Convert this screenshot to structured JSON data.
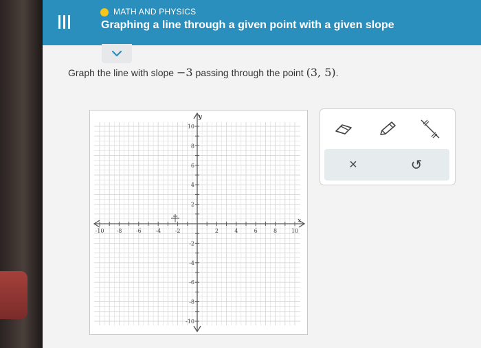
{
  "header": {
    "topic": "MATH AND PHYSICS",
    "title": "Graphing a line through a given point with a given slope"
  },
  "prompt": {
    "text_before": "Graph the line with slope ",
    "slope": "−3",
    "text_middle": " passing through the point ",
    "point": "(3, 5)",
    "text_after": "."
  },
  "graph": {
    "x_axis_label": "x",
    "y_axis_label": "y",
    "x_range": [
      -10,
      10
    ],
    "y_range": [
      -10,
      10
    ],
    "x_tick_labels": [
      "-10",
      "-8",
      "-6",
      "-4",
      "-2",
      "2",
      "4",
      "6",
      "8",
      "10"
    ],
    "y_tick_labels": [
      "10",
      "8",
      "6",
      "4",
      "2",
      "-2",
      "-4",
      "-6",
      "-8",
      "-10"
    ],
    "grid": true
  },
  "tools": {
    "icons": [
      "eraser-icon",
      "pencil-icon",
      "line-segment-icon"
    ],
    "clear_symbol": "×",
    "undo_symbol": "↺"
  },
  "colors": {
    "header": "#2a8fbd",
    "topic_dot": "#f5c518",
    "grid": "#d7d7d7",
    "axes": "#555555"
  }
}
